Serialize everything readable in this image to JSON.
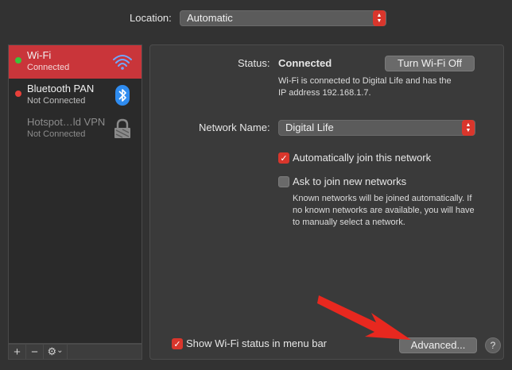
{
  "location": {
    "label": "Location:",
    "value": "Automatic"
  },
  "sidebar": {
    "services": [
      {
        "name": "Wi-Fi",
        "status": "Connected",
        "dot_color": "#3bc33b",
        "icon": "wifi-icon",
        "selected": true
      },
      {
        "name": "Bluetooth PAN",
        "status": "Not Connected",
        "dot_color": "#e8403a",
        "icon": "bluetooth-icon",
        "selected": false
      },
      {
        "name": "Hotspot…ld VPN",
        "status": "Not Connected",
        "dot_color": "",
        "icon": "lock-icon",
        "selected": false
      }
    ],
    "footer": {
      "add": "+",
      "remove": "−",
      "gear": "⚙",
      "chevron": "⌄"
    }
  },
  "status": {
    "label": "Status:",
    "value": "Connected",
    "button": "Turn Wi-Fi Off",
    "desc_line1": "Wi-Fi is connected to Digital Life and has the",
    "desc_line2": "IP address 192.168.1.7."
  },
  "network": {
    "label": "Network Name:",
    "value": "Digital Life"
  },
  "options": {
    "auto_join": {
      "label": "Automatically join this network",
      "checked": true
    },
    "ask_join": {
      "label": "Ask to join new networks",
      "checked": false
    },
    "note_line1": "Known networks will be joined automatically. If",
    "note_line2": "no known networks are available, you will have",
    "note_line3": "to manually select a network."
  },
  "menubar": {
    "label": "Show Wi-Fi status in menu bar",
    "checked": true
  },
  "advanced": {
    "label": "Advanced..."
  },
  "help": {
    "label": "?"
  },
  "colors": {
    "accent": "#d9362c",
    "arrow": "#e8281f",
    "selected_row": "#c9353a"
  }
}
